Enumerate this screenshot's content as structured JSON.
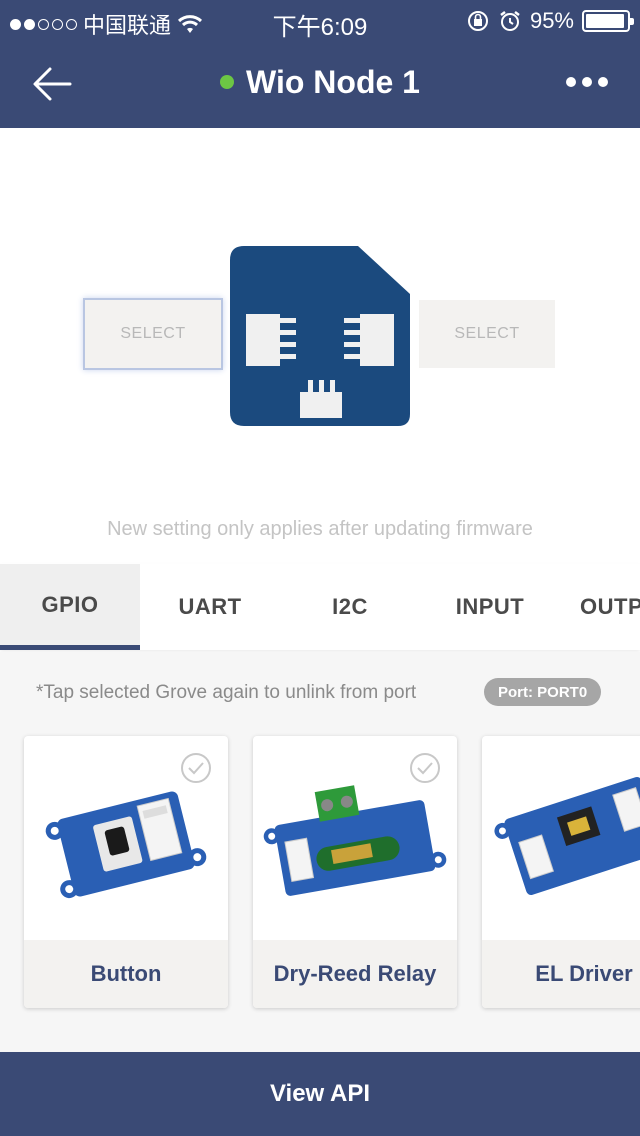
{
  "status_bar": {
    "carrier": "中国联通",
    "signal_dots_filled": 2,
    "signal_dots_total": 5,
    "time": "下午6:09",
    "battery_percent": "95%",
    "battery_level": 0.95,
    "icons": [
      "wifi-icon",
      "orientation-lock-icon",
      "alarm-icon",
      "battery-icon"
    ]
  },
  "nav": {
    "back_icon": "arrow-left-icon",
    "title": "Wio Node 1",
    "status_color": "#6cc644",
    "more_icon": "more-dots-icon"
  },
  "board": {
    "left_select": "SELECT",
    "right_select": "SELECT",
    "note": "New setting only applies after updating firmware"
  },
  "tabs": [
    {
      "label": "GPIO",
      "active": true
    },
    {
      "label": "UART",
      "active": false
    },
    {
      "label": "I2C",
      "active": false
    },
    {
      "label": "INPUT",
      "active": false
    },
    {
      "label": "OUTP",
      "active": false
    }
  ],
  "grove": {
    "hint": "*Tap selected Grove again to unlink from port",
    "port_badge": "Port: PORT0",
    "cards": [
      {
        "name": "Button",
        "checkable": true
      },
      {
        "name": "Dry-Reed Relay",
        "checkable": true
      },
      {
        "name": "EL Driver",
        "checkable": false
      }
    ]
  },
  "footer": {
    "view_api": "View API"
  },
  "colors": {
    "primary": "#3a4a75",
    "accent_green": "#6cc644",
    "board_blue": "#1b4a7e"
  }
}
